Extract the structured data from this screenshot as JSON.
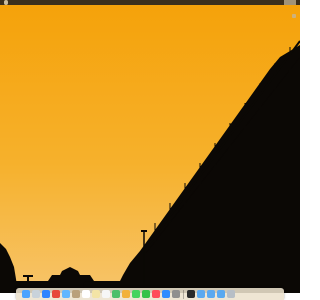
{
  "desktop": {
    "wallpaper": {
      "sky_top": "#f5a20a",
      "sky_mid": "#f6b12c",
      "sky_bottom": "#f7c46a",
      "silhouette": "#0b0805"
    }
  },
  "dock": {
    "items": [
      {
        "icon": "finder-icon",
        "color": "#4aa3ff"
      },
      {
        "icon": "launchpad-icon",
        "color": "#c9d2da"
      },
      {
        "icon": "safari-icon",
        "color": "#2f84ff"
      },
      {
        "icon": "chrome-icon",
        "color": "#e7473b"
      },
      {
        "icon": "mail-icon",
        "color": "#62b7ff"
      },
      {
        "icon": "contacts-icon",
        "color": "#b9a07b"
      },
      {
        "icon": "calendar-icon",
        "color": "#ffffff"
      },
      {
        "icon": "notes-icon",
        "color": "#f3e4a6"
      },
      {
        "icon": "reminders-icon",
        "color": "#f6f6f6"
      },
      {
        "icon": "maps-icon",
        "color": "#4bbf6a"
      },
      {
        "icon": "photos-icon",
        "color": "#f2b13b"
      },
      {
        "icon": "messages-icon",
        "color": "#44d45f"
      },
      {
        "icon": "facetime-icon",
        "color": "#36c24a"
      },
      {
        "icon": "music-icon",
        "color": "#ff4b5a"
      },
      {
        "icon": "app-store-icon",
        "color": "#2e8cff"
      },
      {
        "icon": "settings-icon",
        "color": "#8f8f8f"
      },
      {
        "icon": "terminal-icon",
        "color": "#2a2a2a"
      },
      {
        "icon": "folder-icon",
        "color": "#5aa9f0"
      },
      {
        "icon": "folder-icon",
        "color": "#5aa9f0"
      },
      {
        "icon": "folder-icon",
        "color": "#5aa9f0"
      },
      {
        "icon": "trash-icon",
        "color": "#b7bec6"
      }
    ]
  }
}
